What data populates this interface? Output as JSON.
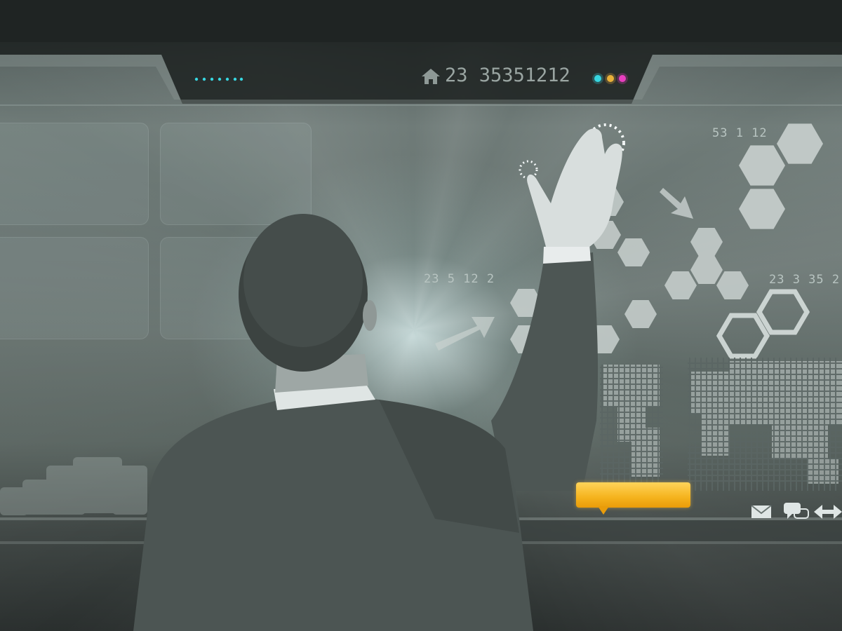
{
  "scene": "man-touching-futuristic-interface",
  "header": {
    "status_number": "23 35351212",
    "icons": [
      "home-icon",
      "cyan-dot-row",
      "indicator-lights"
    ]
  },
  "labels": {
    "top_right": "53 1 12",
    "middle_left": "23 5 12 2",
    "middle_right": "23 3 35 2"
  },
  "footer": {
    "icons": [
      "mail-icon",
      "chat-icon",
      "double-arrow-icon"
    ],
    "highlight_button_label": ""
  },
  "colors": {
    "accent_cyan": "#37d6e0",
    "accent_magenta": "#e83fbf",
    "accent_orange": "#f5b31d"
  }
}
